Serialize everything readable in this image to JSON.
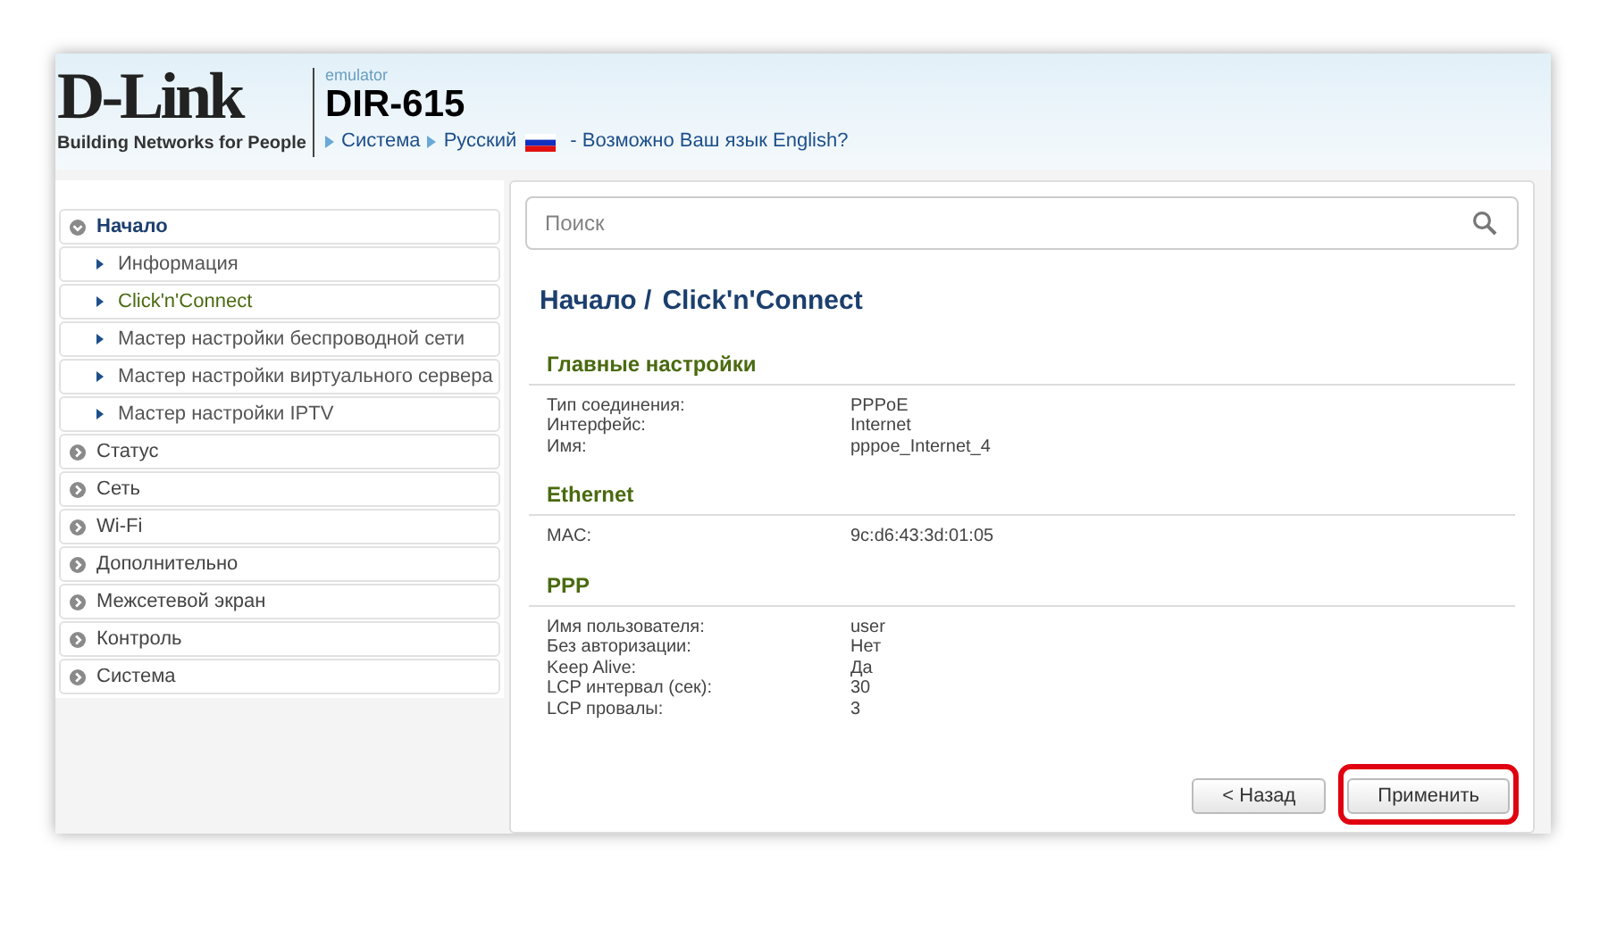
{
  "header": {
    "logo": "D-Link",
    "tagline": "Building Networks for People",
    "product_label": "emulator",
    "model": "DIR-615",
    "links": [
      {
        "label": "Система"
      },
      {
        "label": "Русский"
      }
    ],
    "language_hint": "- Возможно Ваш язык English?"
  },
  "sidebar": {
    "items": [
      {
        "label": "Начало",
        "expanded": true,
        "children": [
          {
            "label": "Информация",
            "selected": false
          },
          {
            "label": "Click'n'Connect",
            "selected": true
          },
          {
            "label": "Мастер настройки беспроводной сети",
            "selected": false
          },
          {
            "label": "Мастер настройки виртуального сервера",
            "selected": false
          },
          {
            "label": "Мастер настройки IPTV",
            "selected": false
          }
        ]
      },
      {
        "label": "Статус",
        "expanded": false
      },
      {
        "label": "Сеть",
        "expanded": false
      },
      {
        "label": "Wi-Fi",
        "expanded": false
      },
      {
        "label": "Дополнительно",
        "expanded": false
      },
      {
        "label": "Межсетевой экран",
        "expanded": false
      },
      {
        "label": "Контроль",
        "expanded": false
      },
      {
        "label": "Система",
        "expanded": false
      }
    ]
  },
  "search": {
    "placeholder": "Поиск"
  },
  "breadcrumb": [
    "Начало /",
    "Click'n'Connect"
  ],
  "sections": [
    {
      "title": "Главные настройки",
      "rows": [
        {
          "label": "Тип соединения:",
          "value": "PPPoE"
        },
        {
          "label": "Интерфейс:",
          "value": "Internet"
        },
        {
          "label": "Имя:",
          "value": "pppoe_Internet_4"
        }
      ]
    },
    {
      "title": "Ethernet",
      "rows": [
        {
          "label": "MAC:",
          "value": "9c:d6:43:3d:01:05"
        }
      ]
    },
    {
      "title": "PPP",
      "rows": [
        {
          "label": "Имя пользователя:",
          "value": "user"
        },
        {
          "label": "Без авторизации:",
          "value": "Нет"
        },
        {
          "label": "Keep Alive:",
          "value": "Да"
        },
        {
          "label": "LCP интервал (сек):",
          "value": "30"
        },
        {
          "label": "LCP провалы:",
          "value": "3"
        }
      ]
    }
  ],
  "buttons": [
    {
      "label": "< Назад",
      "highlighted": false
    },
    {
      "label": "Применить",
      "highlighted": true
    }
  ]
}
